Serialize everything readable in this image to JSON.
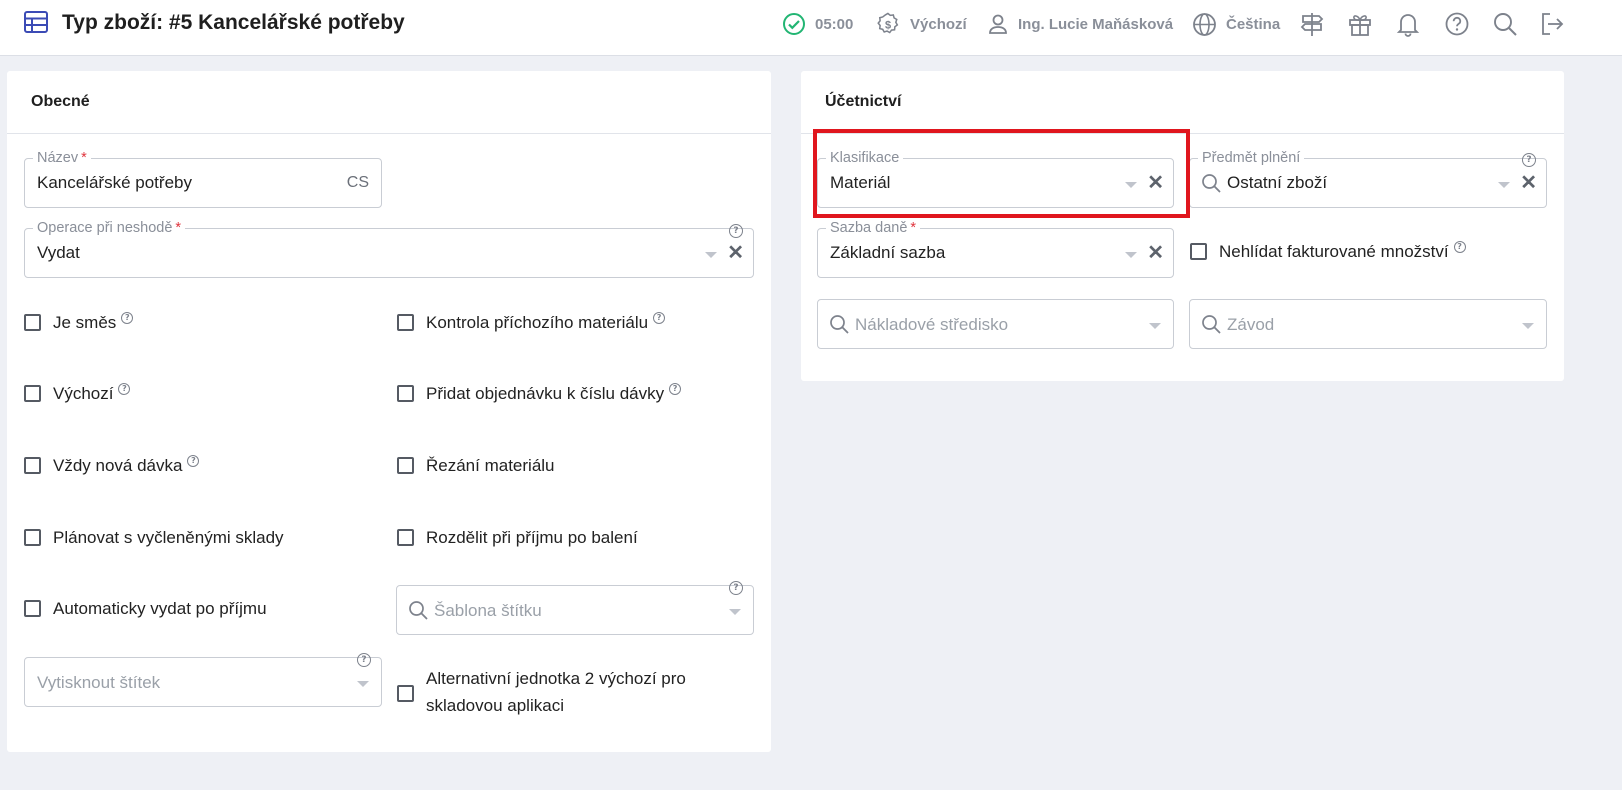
{
  "header": {
    "title": "Typ zboží: #5 Kancelářské potřeby",
    "time": "05:00",
    "currency_profile": "Výchozí",
    "user": "Ing. Lucie Maňásková",
    "language": "Čeština"
  },
  "general": {
    "title": "Obecné",
    "name_field": {
      "label": "Název",
      "value": "Kancelářské potřeby",
      "suffix": "CS"
    },
    "operation_field": {
      "label": "Operace při neshodě",
      "value": "Vydat"
    },
    "checkboxes_left": [
      {
        "label": "Je směs",
        "checked": false,
        "help": true
      },
      {
        "label": "Výchozí",
        "checked": false,
        "help": true
      },
      {
        "label": "Vždy nová dávka",
        "checked": false,
        "help": true
      },
      {
        "label": "Plánovat s vyčleněnými sklady",
        "checked": false,
        "help": false
      },
      {
        "label": "Automaticky vydat po příjmu",
        "checked": false,
        "help": false
      }
    ],
    "checkboxes_right": [
      {
        "label": "Kontrola příchozího materiálu",
        "checked": false,
        "help": true
      },
      {
        "label": "Přidat objednávku k číslu dávky",
        "checked": false,
        "help": true
      },
      {
        "label": "Řezání materiálu",
        "checked": false,
        "help": false
      },
      {
        "label": "Rozdělit při příjmu po balení",
        "checked": false,
        "help": false
      }
    ],
    "label_template_placeholder": "Šablona štítku",
    "print_label_placeholder": "Vytisknout štítek",
    "alt_unit_label": "Alternativní jednotka 2 výchozí pro skladovou aplikaci"
  },
  "accounting": {
    "title": "Účetnictví",
    "classification": {
      "label": "Klasifikace",
      "value": "Materiál"
    },
    "subject": {
      "label": "Předmět plnění",
      "value": "Ostatní zboží"
    },
    "tax_rate": {
      "label": "Sazba daně",
      "value": "Základní sazba"
    },
    "no_invoiced_qty_label": "Nehlídat fakturované množství",
    "cost_center_placeholder": "Nákladové středisko",
    "plant_placeholder": "Závod"
  },
  "colors": {
    "accent": "#3b4bb5",
    "success": "#22b573",
    "required": "#e0343d",
    "highlight": "#e0161e"
  },
  "icons": [
    "table-icon",
    "check-circle-icon",
    "dollar-gear-icon",
    "user-icon",
    "globe-icon",
    "signpost-icon",
    "gift-icon",
    "bell-icon",
    "help-circle-icon",
    "search-icon",
    "logout-icon"
  ]
}
